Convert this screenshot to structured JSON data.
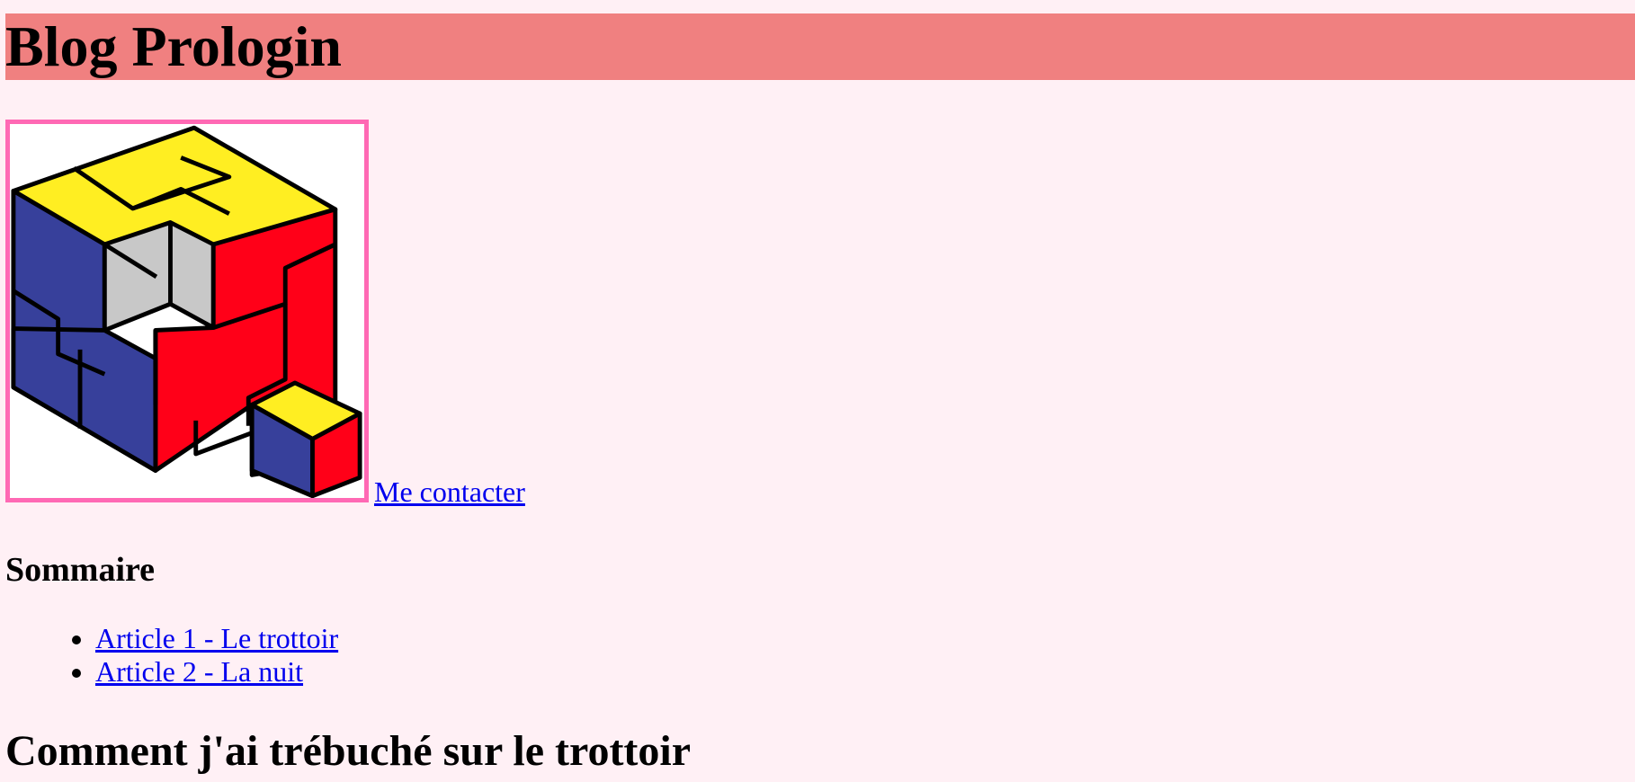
{
  "header": {
    "title": "Blog Prologin"
  },
  "contact": {
    "logo_icon": "prologin-cube-logo-icon",
    "link_label": " Me contacter"
  },
  "summary": {
    "heading": "Sommaire",
    "items": [
      {
        "label": "Article 1 - Le trottoir"
      },
      {
        "label": "Article 2 - La nuit"
      }
    ]
  },
  "article": {
    "title": "Comment j'ai trébuché sur le trottoir"
  },
  "colors": {
    "page_background": "#fff0f5",
    "header_background": "#f08080",
    "logo_border": "#ff69b4",
    "link": "#0000ee",
    "cube_yellow": "#ffee22",
    "cube_blue": "#37409b",
    "cube_red": "#ff0018",
    "cube_grey": "#c8c8c8"
  }
}
